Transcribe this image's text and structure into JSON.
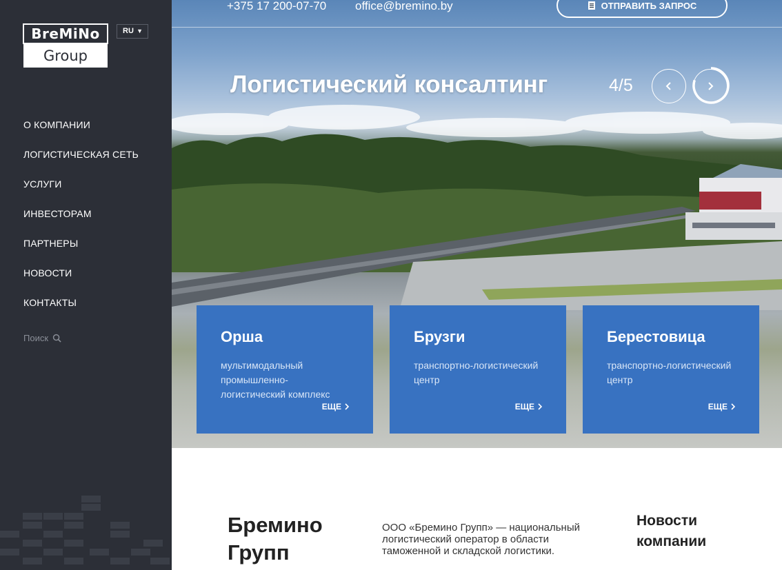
{
  "logo": {
    "line1": "BreMiNo",
    "line2": "Group"
  },
  "language": {
    "selected": "RU"
  },
  "nav": {
    "items": [
      {
        "label": "О компании"
      },
      {
        "label": "Логистическая сеть"
      },
      {
        "label": "Услуги"
      },
      {
        "label": "Инвесторам"
      },
      {
        "label": "Партнеры"
      },
      {
        "label": "Новости"
      },
      {
        "label": "Контакты"
      }
    ]
  },
  "search": {
    "label": "Поиск",
    "icon": "search-icon"
  },
  "header": {
    "phone": "+375 17 200-07-70",
    "email": "office@bremino.by",
    "request_label": "Отправить запрос",
    "request_icon": "document-icon"
  },
  "slider": {
    "title": "Логистический консалтинг",
    "counter": "4/5",
    "current": 4,
    "total": 5,
    "prev_icon": "chevron-left-icon",
    "next_icon": "chevron-right-icon"
  },
  "cards": [
    {
      "title": "Орша",
      "text": "мультимодальный промышленно-логистический комплекс",
      "more": "ЕЩЕ"
    },
    {
      "title": "Брузги",
      "text": "транспортно-логистический центр",
      "more": "ЕЩЕ"
    },
    {
      "title": "Берестовица",
      "text": "транспортно-логистический центр",
      "more": "ЕЩЕ"
    }
  ],
  "about": {
    "title": "Бремино Групп",
    "text": "ООО «Бремино Групп» — национальный логистический оператор в области таможенной и складской логистики."
  },
  "news": {
    "title": "Новости компании"
  },
  "colors": {
    "sidebar": "#2c2f37",
    "card": "#3872c1",
    "text_dark": "#222222"
  }
}
